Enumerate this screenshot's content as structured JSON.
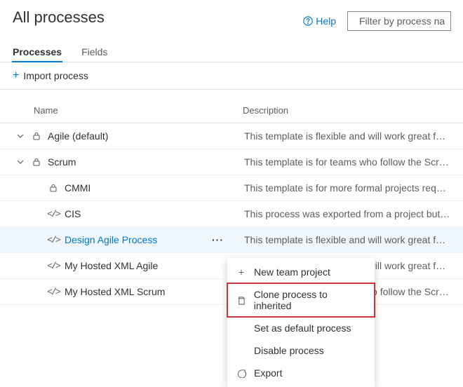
{
  "header": {
    "title": "All processes",
    "help_label": "Help",
    "filter_placeholder": "Filter by process na"
  },
  "tabs": [
    {
      "label": "Processes",
      "active": true
    },
    {
      "label": "Fields",
      "active": false
    }
  ],
  "toolbar": {
    "import_label": "Import process"
  },
  "columns": {
    "name": "Name",
    "description": "Description"
  },
  "rows": [
    {
      "name": "Agile (default)",
      "desc": "This template is flexible and will work great for ...",
      "icon": "lock",
      "expandable": true,
      "indent": 0
    },
    {
      "name": "Scrum",
      "desc": "This template is for teams who follow the Scru...",
      "icon": "lock",
      "expandable": true,
      "indent": 0
    },
    {
      "name": "CMMI",
      "desc": "This template is for more formal projects requi...",
      "icon": "lock",
      "expandable": false,
      "indent": 1
    },
    {
      "name": "CIS",
      "desc": "This process was exported from a project but n...",
      "icon": "code",
      "expandable": false,
      "indent": 1
    },
    {
      "name": "Design Agile Process",
      "desc": "This template is flexible and will work great for ...",
      "icon": "code",
      "expandable": false,
      "indent": 1,
      "selected": true,
      "link": true
    },
    {
      "name": "My Hosted XML Agile",
      "desc": "This template is flexible and will work great for ...",
      "icon": "code",
      "expandable": false,
      "indent": 1
    },
    {
      "name": "My Hosted XML Scrum",
      "desc": "This template is for teams who follow the Scru...",
      "icon": "code",
      "expandable": false,
      "indent": 1
    }
  ],
  "context_menu": {
    "items": [
      {
        "label": "New team project",
        "icon": "plus"
      },
      {
        "label": "Clone process to inherited",
        "icon": "copy",
        "highlighted": true
      },
      {
        "label": "Set as default process",
        "icon": "none"
      },
      {
        "label": "Disable process",
        "icon": "none"
      },
      {
        "label": "Export",
        "icon": "export"
      }
    ]
  }
}
